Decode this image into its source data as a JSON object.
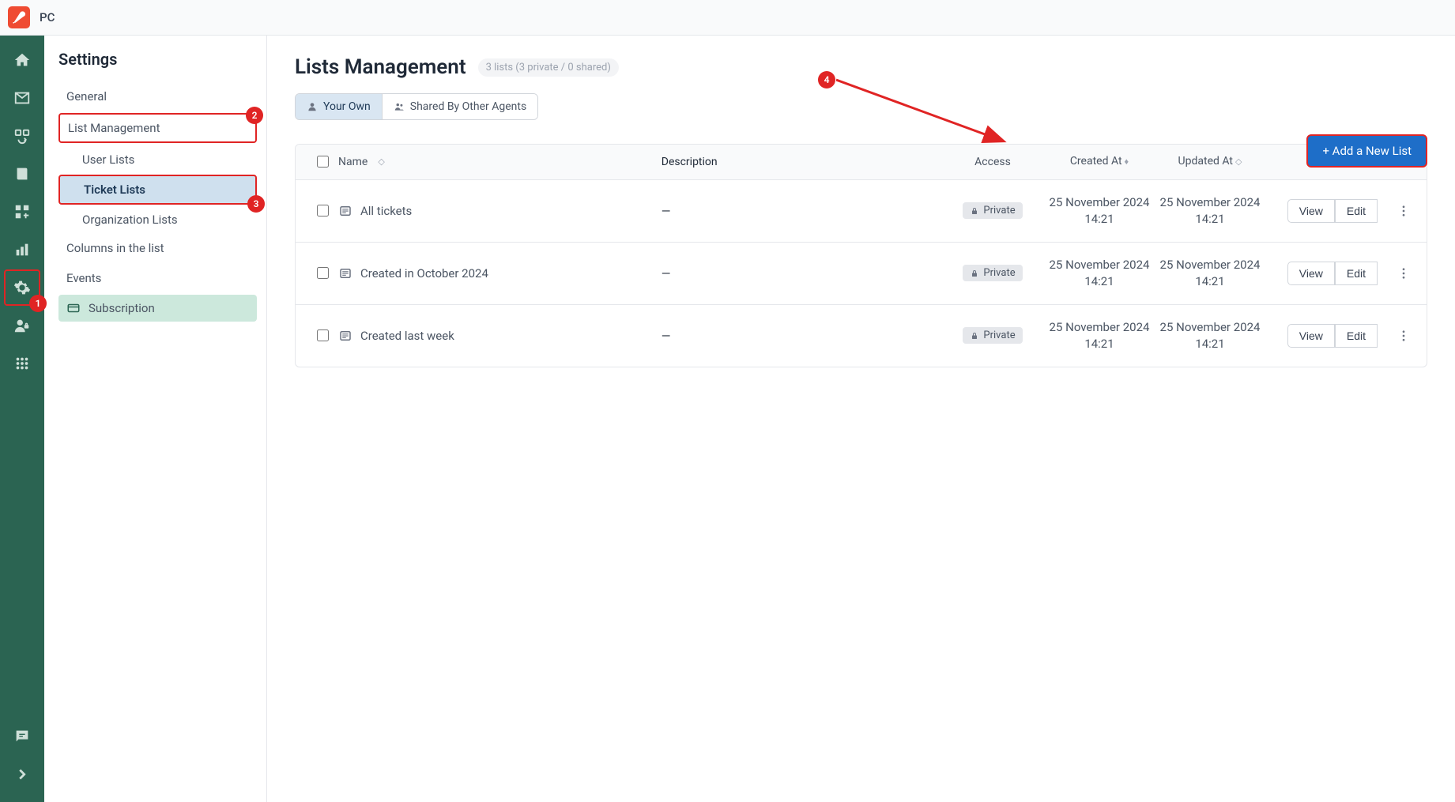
{
  "brand": "PC",
  "sidebar": {
    "heading": "Settings",
    "general": "General",
    "list_management": "List Management",
    "user_lists": "User Lists",
    "ticket_lists": "Ticket Lists",
    "org_lists": "Organization Lists",
    "columns": "Columns in the list",
    "events": "Events",
    "subscription": "Subscription"
  },
  "page": {
    "title": "Lists Management",
    "count_badge": "3 lists (3 private / 0 shared)",
    "tab_own": "Your Own",
    "tab_shared": "Shared By Other Agents",
    "add_btn": "+ Add a New List"
  },
  "table": {
    "h_name": "Name",
    "h_desc": "Description",
    "h_access": "Access",
    "h_created": "Created At",
    "h_updated": "Updated At",
    "rows": [
      {
        "name": "All tickets",
        "desc": "—",
        "access": "Private",
        "created": "25 November 2024 14:21",
        "updated": "25 November 2024 14:21"
      },
      {
        "name": "Created in October 2024",
        "desc": "—",
        "access": "Private",
        "created": "25 November 2024 14:21",
        "updated": "25 November 2024 14:21"
      },
      {
        "name": "Created last week",
        "desc": "—",
        "access": "Private",
        "created": "25 November 2024 14:21",
        "updated": "25 November 2024 14:21"
      }
    ],
    "view": "View",
    "edit": "Edit"
  },
  "annotations": {
    "n1": "1",
    "n2": "2",
    "n3": "3",
    "n4": "4"
  }
}
